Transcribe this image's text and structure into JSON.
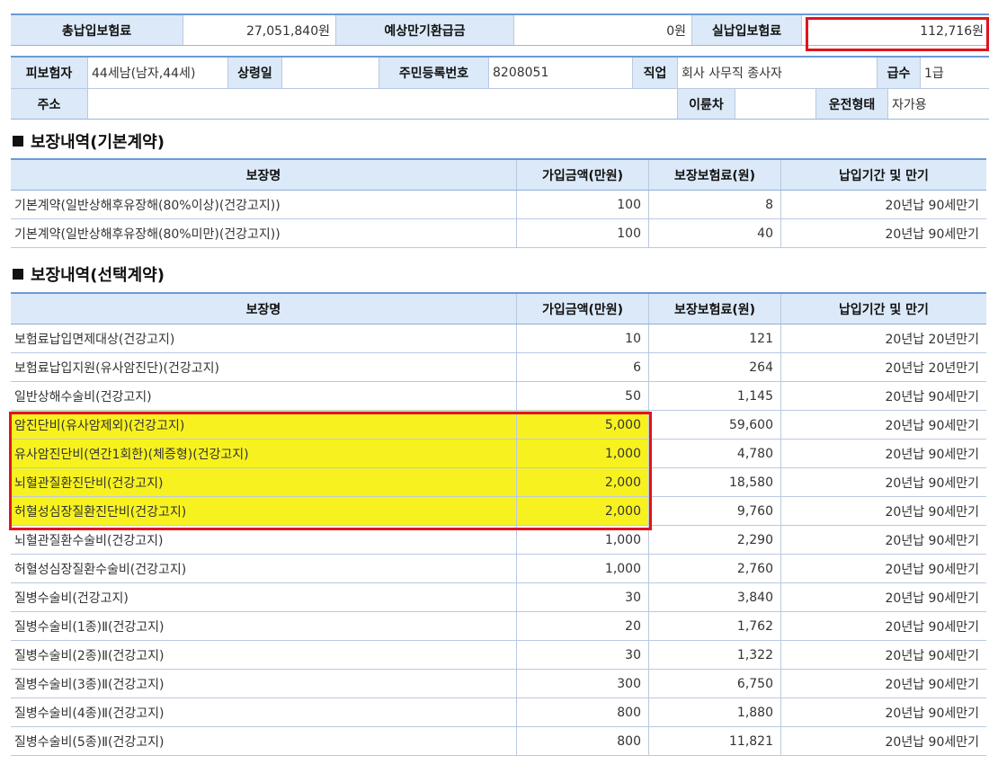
{
  "summary": {
    "total_premium_label": "총납입보험료",
    "total_premium_value": "27,051,840원",
    "refund_label": "예상만기환급금",
    "refund_value": "0원",
    "actual_premium_label": "실납입보험료",
    "actual_premium_value": "112,716원"
  },
  "insured": {
    "insured_label": "피보험자",
    "insured_value": "44세남(남자,44세)",
    "sangryeong_label": "상령일",
    "sangryeong_value": "",
    "rrn_label": "주민등록번호",
    "rrn_value": "8208051",
    "job_label": "직업",
    "job_value": "회사 사무직 종사자",
    "grade_label": "급수",
    "grade_value": "1급",
    "address_label": "주소",
    "address_value": "",
    "bike_label": "이륜차",
    "bike_value": "",
    "drive_label": "운전형태",
    "drive_value": "자가용"
  },
  "sections": {
    "basic_title": "보장내역(기본계약)",
    "optional_title": "보장내역(선택계약)"
  },
  "columns": [
    "보장명",
    "가입금액(만원)",
    "보장보험료(원)",
    "납입기간 및 만기"
  ],
  "basic_rows": [
    {
      "name": "기본계약(일반상해후유장해(80%이상)(건강고지))",
      "amount": "100",
      "premium": "8",
      "term": "20년납 90세만기"
    },
    {
      "name": "기본계약(일반상해후유장해(80%미만)(건강고지))",
      "amount": "100",
      "premium": "40",
      "term": "20년납 90세만기"
    }
  ],
  "optional_rows": [
    {
      "name": "보험료납입면제대상(건강고지)",
      "amount": "10",
      "premium": "121",
      "term": "20년납 20년만기",
      "highlight": false
    },
    {
      "name": "보험료납입지원(유사암진단)(건강고지)",
      "amount": "6",
      "premium": "264",
      "term": "20년납 20년만기",
      "highlight": false
    },
    {
      "name": "일반상해수술비(건강고지)",
      "amount": "50",
      "premium": "1,145",
      "term": "20년납 90세만기",
      "highlight": false
    },
    {
      "name": "암진단비(유사암제외)(건강고지)",
      "amount": "5,000",
      "premium": "59,600",
      "term": "20년납 90세만기",
      "highlight": true
    },
    {
      "name": "유사암진단비(연간1회한)(체증형)(건강고지)",
      "amount": "1,000",
      "premium": "4,780",
      "term": "20년납 90세만기",
      "highlight": true
    },
    {
      "name": "뇌혈관질환진단비(건강고지)",
      "amount": "2,000",
      "premium": "18,580",
      "term": "20년납 90세만기",
      "highlight": true
    },
    {
      "name": "허혈성심장질환진단비(건강고지)",
      "amount": "2,000",
      "premium": "9,760",
      "term": "20년납 90세만기",
      "highlight": true
    },
    {
      "name": "뇌혈관질환수술비(건강고지)",
      "amount": "1,000",
      "premium": "2,290",
      "term": "20년납 90세만기",
      "highlight": false
    },
    {
      "name": "허혈성심장질환수술비(건강고지)",
      "amount": "1,000",
      "premium": "2,760",
      "term": "20년납 90세만기",
      "highlight": false
    },
    {
      "name": "질병수술비(건강고지)",
      "amount": "30",
      "premium": "3,840",
      "term": "20년납 90세만기",
      "highlight": false
    },
    {
      "name": "질병수술비(1종)Ⅱ(건강고지)",
      "amount": "20",
      "premium": "1,762",
      "term": "20년납 90세만기",
      "highlight": false
    },
    {
      "name": "질병수술비(2종)Ⅱ(건강고지)",
      "amount": "30",
      "premium": "1,322",
      "term": "20년납 90세만기",
      "highlight": false
    },
    {
      "name": "질병수술비(3종)Ⅱ(건강고지)",
      "amount": "300",
      "premium": "6,750",
      "term": "20년납 90세만기",
      "highlight": false
    },
    {
      "name": "질병수술비(4종)Ⅱ(건강고지)",
      "amount": "800",
      "premium": "1,880",
      "term": "20년납 90세만기",
      "highlight": false
    },
    {
      "name": "질병수술비(5종)Ⅱ(건강고지)",
      "amount": "800",
      "premium": "11,821",
      "term": "20년납 90세만기",
      "highlight": false
    }
  ]
}
